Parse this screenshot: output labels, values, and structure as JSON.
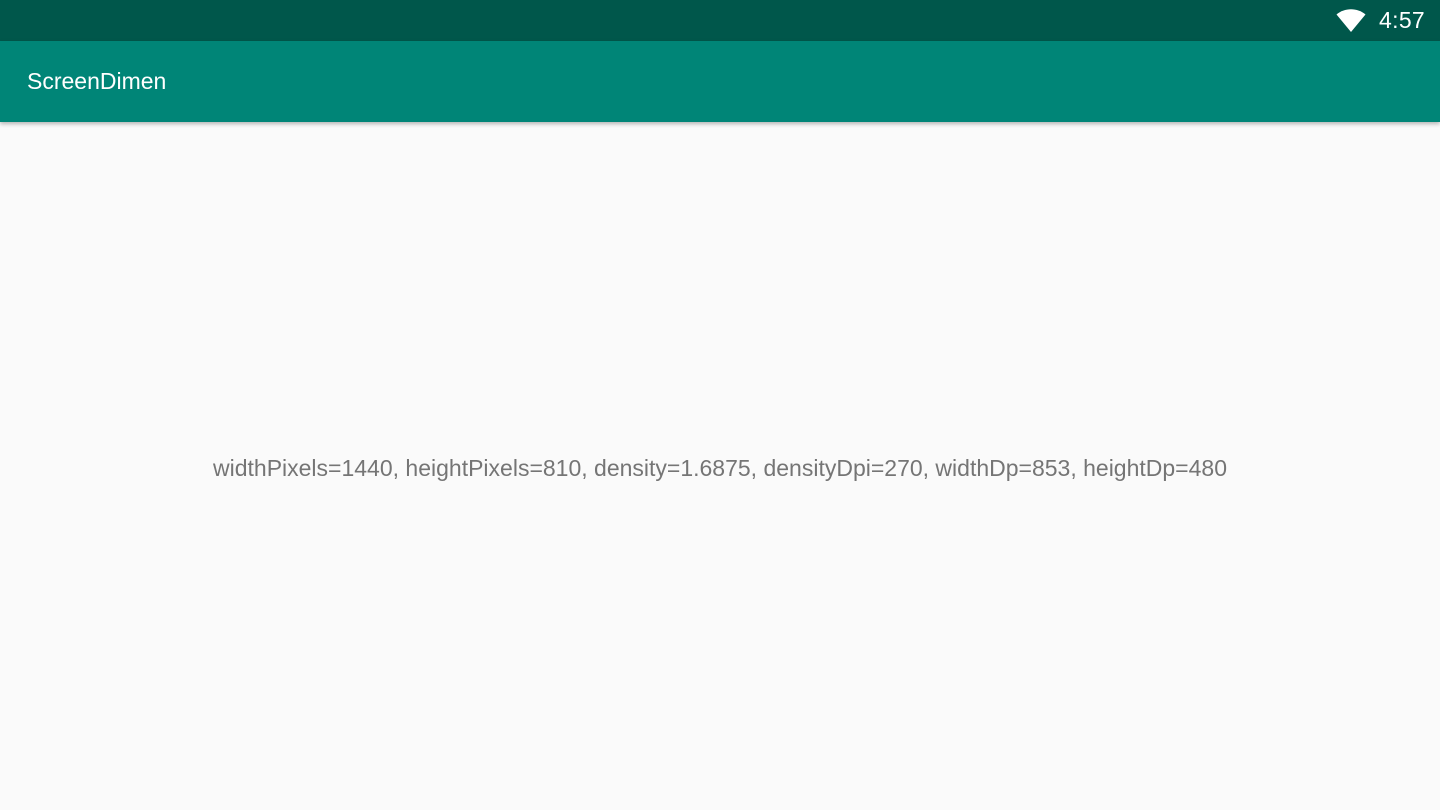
{
  "status_bar": {
    "wifi_icon": "wifi-icon",
    "time": "4:57"
  },
  "app_bar": {
    "title": "ScreenDimen"
  },
  "content": {
    "metrics": "widthPixels=1440, heightPixels=810, density=1.6875, densityDpi=270, widthDp=853, heightDp=480"
  },
  "colors": {
    "status_bar": "#00574b",
    "app_bar": "#008577",
    "background": "#fafafa",
    "text": "#757575"
  }
}
